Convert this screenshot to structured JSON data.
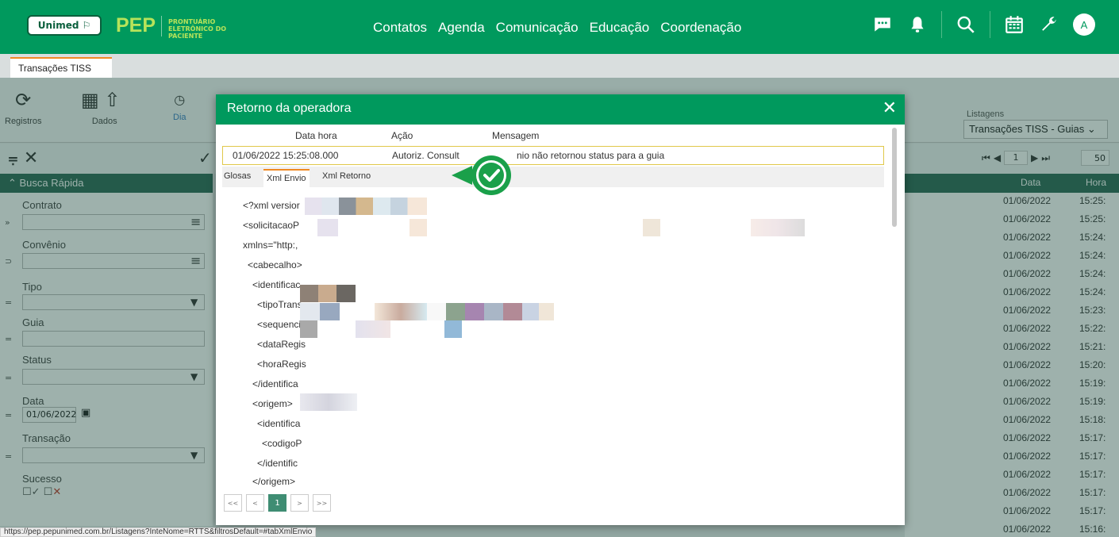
{
  "header": {
    "brand": "Unimed",
    "product": "PEP",
    "product_sub": "PRONTUÁRIO ELETRÔNICO DO PACIENTE",
    "nav": [
      "Contatos",
      "Agenda",
      "Comunicação",
      "Educação",
      "Coordenação"
    ],
    "avatar": "A",
    "icons": [
      "chat-icon",
      "bell-icon",
      "search-icon",
      "calendar-icon",
      "wrench-icon"
    ]
  },
  "tabs": [
    {
      "label": "Transações TISS",
      "active": true
    }
  ],
  "toolbar": {
    "registros": "Registros",
    "dados": "Dados",
    "dia": "Dia",
    "listagens_label": "Listagens",
    "listagens_value": "Transações TISS - Guias"
  },
  "sidebar": {
    "title": "Busca Rápida",
    "fields": {
      "contrato": "Contrato",
      "convenio": "Convênio",
      "tipo": "Tipo",
      "guia": "Guia",
      "status": "Status",
      "data": "Data",
      "data_value": "01/06/2022",
      "transacao": "Transação",
      "sucesso": "Sucesso"
    }
  },
  "table": {
    "headers": {
      "data": "Data",
      "hora": "Hora"
    },
    "pager_page": "1",
    "page_size": "50",
    "rows": [
      {
        "data": "01/06/2022",
        "hora": "15:25:"
      },
      {
        "data": "01/06/2022",
        "hora": "15:25:"
      },
      {
        "data": "01/06/2022",
        "hora": "15:24:"
      },
      {
        "data": "01/06/2022",
        "hora": "15:24:"
      },
      {
        "data": "01/06/2022",
        "hora": "15:24:"
      },
      {
        "data": "01/06/2022",
        "hora": "15:24:"
      },
      {
        "data": "01/06/2022",
        "hora": "15:23:"
      },
      {
        "data": "01/06/2022",
        "hora": "15:22:"
      },
      {
        "data": "01/06/2022",
        "hora": "15:21:"
      },
      {
        "data": "01/06/2022",
        "hora": "15:20:"
      },
      {
        "data": "01/06/2022",
        "hora": "15:19:"
      },
      {
        "data": "01/06/2022",
        "hora": "15:19:"
      },
      {
        "data": "01/06/2022",
        "hora": "15:18:"
      },
      {
        "data": "01/06/2022",
        "hora": "15:17:"
      },
      {
        "data": "01/06/2022",
        "hora": "15:17:"
      },
      {
        "data": "01/06/2022",
        "hora": "15:17:"
      },
      {
        "data": "01/06/2022",
        "hora": "15:17:"
      },
      {
        "data": "01/06/2022",
        "hora": "15:17:"
      },
      {
        "data": "01/06/2022",
        "hora": "15:16:"
      }
    ]
  },
  "modal": {
    "title": "Retorno da operadora",
    "columns": {
      "data_hora": "Data hora",
      "acao": "Ação",
      "mensagem": "Mensagem"
    },
    "row": {
      "data_hora": "01/06/2022 15:25:08.000",
      "acao": "Autoriz. Consult",
      "mensagem": "nio não retornou status para a guia"
    },
    "subtabs": [
      "Glosas",
      "Xml Envio",
      "Xml Retorno"
    ],
    "xml_lines": [
      "<?xml versior",
      "<solicitacaoP",
      "xmlns=\"http:,",
      "<cabecalho>",
      "<identificac",
      "<tipoTrans",
      "<sequenci",
      "<dataRegis",
      "<horaRegis",
      "</identifica",
      "<origem>",
      "<identifica",
      "<codigoP",
      "</identific",
      "</origem>"
    ],
    "pager": [
      "<<",
      "<",
      "1",
      ">",
      ">>"
    ],
    "active_page": "1"
  },
  "statusbar": "https://pep.pepunimed.com.br/Listagens?InteNome=RTTS&filtrosDefault=#tabXmlEnvio",
  "colors": {
    "brand_green": "#00995d",
    "lime": "#b7e35a",
    "accent_orange": "#f08a24",
    "dark_green": "#2d6a56"
  }
}
